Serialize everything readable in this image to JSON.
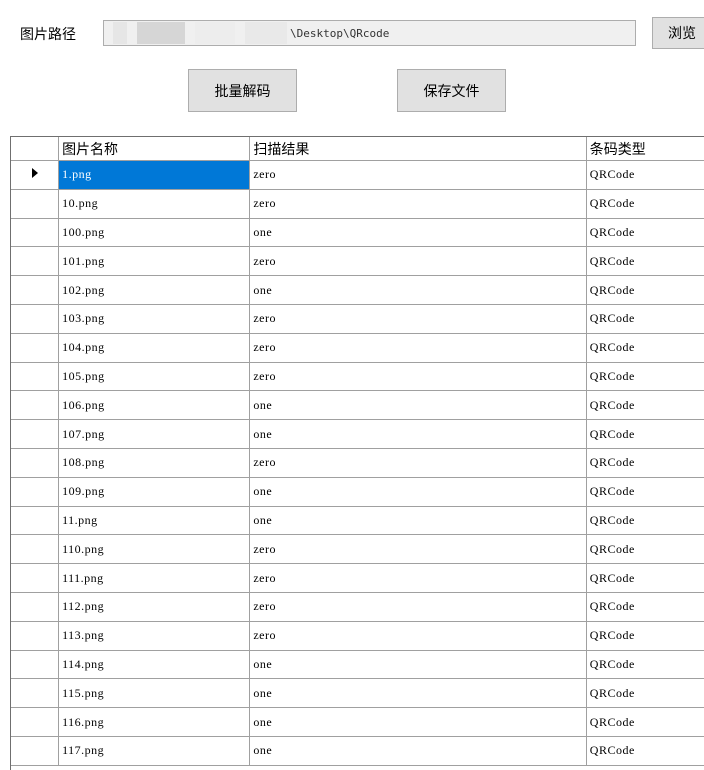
{
  "path_label": "图片路径",
  "path_value": "\\Desktop\\QRcode",
  "browse_label": "浏览",
  "batch_decode_label": "批量解码",
  "save_file_label": "保存文件",
  "columns": [
    "图片名称",
    "扫描结果",
    "条码类型"
  ],
  "rows": [
    {
      "name": "1.png",
      "result": "zero",
      "type": "QRCode"
    },
    {
      "name": "10.png",
      "result": "zero",
      "type": "QRCode"
    },
    {
      "name": "100.png",
      "result": "one",
      "type": "QRCode"
    },
    {
      "name": "101.png",
      "result": "zero",
      "type": "QRCode"
    },
    {
      "name": "102.png",
      "result": "one",
      "type": "QRCode"
    },
    {
      "name": "103.png",
      "result": "zero",
      "type": "QRCode"
    },
    {
      "name": "104.png",
      "result": "zero",
      "type": "QRCode"
    },
    {
      "name": "105.png",
      "result": "zero",
      "type": "QRCode"
    },
    {
      "name": "106.png",
      "result": "one",
      "type": "QRCode"
    },
    {
      "name": "107.png",
      "result": "one",
      "type": "QRCode"
    },
    {
      "name": "108.png",
      "result": "zero",
      "type": "QRCode"
    },
    {
      "name": "109.png",
      "result": "one",
      "type": "QRCode"
    },
    {
      "name": "11.png",
      "result": "one",
      "type": "QRCode"
    },
    {
      "name": "110.png",
      "result": "zero",
      "type": "QRCode"
    },
    {
      "name": "111.png",
      "result": "zero",
      "type": "QRCode"
    },
    {
      "name": "112.png",
      "result": "zero",
      "type": "QRCode"
    },
    {
      "name": "113.png",
      "result": "zero",
      "type": "QRCode"
    },
    {
      "name": "114.png",
      "result": "one",
      "type": "QRCode"
    },
    {
      "name": "115.png",
      "result": "one",
      "type": "QRCode"
    },
    {
      "name": "116.png",
      "result": "one",
      "type": "QRCode"
    },
    {
      "name": "117.png",
      "result": "one",
      "type": "QRCode"
    }
  ],
  "selection_color": "#0078d7"
}
